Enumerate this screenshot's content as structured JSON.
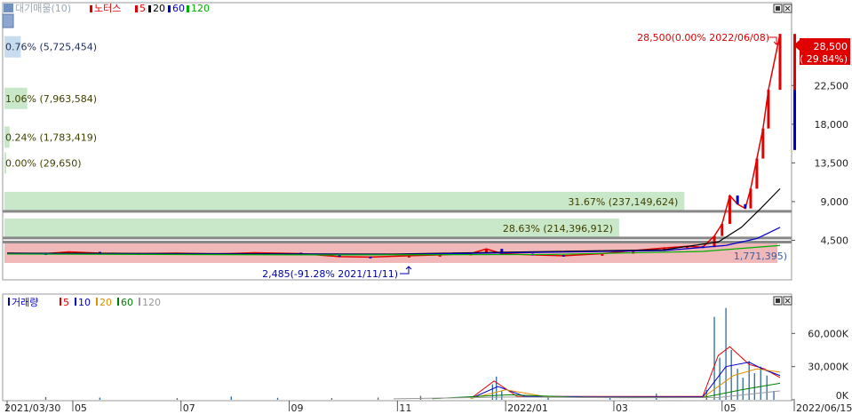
{
  "chart_data": [
    {
      "type": "candlestick",
      "legend_title": "대기매물(10)",
      "legend": [
        {
          "name": "노터스",
          "color": "#e00000"
        },
        {
          "name": "5",
          "color": "#e00000"
        },
        {
          "name": "20",
          "color": "#000000"
        },
        {
          "name": "60",
          "color": "#0000cc"
        },
        {
          "name": "120",
          "color": "#00b000"
        }
      ],
      "y_ticks": [
        "22,500",
        "18,000",
        "13,500",
        "9,000",
        "4,500"
      ],
      "y_tick_values": [
        22500,
        18000,
        13500,
        9000,
        4500
      ],
      "ylim": [
        0,
        31000
      ],
      "price_box": {
        "price": "28,500",
        "change": "( 29.84%)"
      },
      "annotations": {
        "high": "28,500(0.00% 2022/06/08)",
        "low": "2,485(-91.28% 2021/11/11)",
        "ma_label": "1,771,395)"
      },
      "volume_profile": [
        {
          "label": "0.76% (5,725,454)",
          "price": 27000,
          "pct": 0.76
        },
        {
          "label": "1.06% (7,963,584)",
          "price": 21000,
          "pct": 1.06
        },
        {
          "label": "0.24% (1,783,419)",
          "price": 16500,
          "pct": 0.24
        },
        {
          "label": "0.00% (29,650)",
          "price": 13500,
          "pct": 0.0
        },
        {
          "label": "31.67% (237,149,624)",
          "price": 9000,
          "pct": 31.67
        },
        {
          "label": "28.63% (214,396,912)",
          "price": 5900,
          "pct": 28.63
        },
        {
          "label": "",
          "price": 3000,
          "pct": 36.0
        }
      ],
      "price_series": [
        {
          "t": 0.0,
          "close": 3000
        },
        {
          "t": 0.05,
          "close": 2950
        },
        {
          "t": 0.08,
          "close": 3150
        },
        {
          "t": 0.12,
          "close": 3000
        },
        {
          "t": 0.17,
          "close": 2950
        },
        {
          "t": 0.22,
          "close": 3000
        },
        {
          "t": 0.27,
          "close": 2900
        },
        {
          "t": 0.32,
          "close": 3050
        },
        {
          "t": 0.38,
          "close": 2950
        },
        {
          "t": 0.43,
          "close": 2600
        },
        {
          "t": 0.47,
          "close": 2550
        },
        {
          "t": 0.52,
          "close": 2700
        },
        {
          "t": 0.56,
          "close": 2800
        },
        {
          "t": 0.6,
          "close": 2950
        },
        {
          "t": 0.62,
          "close": 3500
        },
        {
          "t": 0.64,
          "close": 2950
        },
        {
          "t": 0.68,
          "close": 2800
        },
        {
          "t": 0.72,
          "close": 2700
        },
        {
          "t": 0.77,
          "close": 2950
        },
        {
          "t": 0.81,
          "close": 3300
        },
        {
          "t": 0.85,
          "close": 3600
        },
        {
          "t": 0.88,
          "close": 3800
        },
        {
          "t": 0.9,
          "close": 3700
        },
        {
          "t": 0.915,
          "close": 5000
        },
        {
          "t": 0.925,
          "close": 6400
        },
        {
          "t": 0.935,
          "close": 9700
        },
        {
          "t": 0.945,
          "close": 8700
        },
        {
          "t": 0.955,
          "close": 8200
        },
        {
          "t": 0.962,
          "close": 10500
        },
        {
          "t": 0.97,
          "close": 14000
        },
        {
          "t": 0.978,
          "close": 17500
        },
        {
          "t": 0.985,
          "close": 22000
        },
        {
          "t": 1.0,
          "close": 28500
        }
      ],
      "ma_series": [
        {
          "name": "20",
          "color": "#000000",
          "points": [
            [
              0.0,
              3000
            ],
            [
              0.5,
              2900
            ],
            [
              0.85,
              3400
            ],
            [
              0.92,
              4300
            ],
            [
              0.95,
              6000
            ],
            [
              0.975,
              8200
            ],
            [
              1.0,
              10500
            ]
          ]
        },
        {
          "name": "60",
          "color": "#0000cc",
          "points": [
            [
              0.0,
              2950
            ],
            [
              0.5,
              2850
            ],
            [
              0.85,
              3300
            ],
            [
              0.93,
              3900
            ],
            [
              0.97,
              4700
            ],
            [
              1.0,
              6000
            ]
          ]
        },
        {
          "name": "120",
          "color": "#00b000",
          "points": [
            [
              0.0,
              2900
            ],
            [
              0.4,
              2800
            ],
            [
              0.7,
              2850
            ],
            [
              0.9,
              3200
            ],
            [
              1.0,
              3900
            ]
          ]
        }
      ]
    },
    {
      "type": "bar",
      "legend_title": "거래량",
      "legend": [
        {
          "name": "5",
          "color": "#e00000"
        },
        {
          "name": "10",
          "color": "#0000cc"
        },
        {
          "name": "20",
          "color": "#e09000"
        },
        {
          "name": "60",
          "color": "#008000"
        },
        {
          "name": "120",
          "color": "#999999"
        }
      ],
      "y_ticks": [
        "60,000K",
        "30,000K",
        "0K"
      ],
      "y_tick_values": [
        60000,
        30000,
        0
      ],
      "ylim": [
        0,
        90000
      ],
      "x_ticks": [
        "2021/03/30",
        "05",
        "07",
        "09",
        "11",
        "2022/01",
        "03",
        "05",
        "2022/06/15"
      ],
      "x_tick_positions": [
        0.0,
        0.085,
        0.225,
        0.365,
        0.505,
        0.645,
        0.785,
        0.925,
        1.0
      ],
      "volume": [
        {
          "t": 0.05,
          "v": 2500
        },
        {
          "t": 0.12,
          "v": 2000
        },
        {
          "t": 0.22,
          "v": 1500
        },
        {
          "t": 0.29,
          "v": 3000
        },
        {
          "t": 0.35,
          "v": 1800
        },
        {
          "t": 0.42,
          "v": 1500
        },
        {
          "t": 0.48,
          "v": 2000
        },
        {
          "t": 0.535,
          "v": 3500
        },
        {
          "t": 0.628,
          "v": 14000
        },
        {
          "t": 0.633,
          "v": 21000
        },
        {
          "t": 0.64,
          "v": 8000
        },
        {
          "t": 0.7,
          "v": 2200
        },
        {
          "t": 0.78,
          "v": 2500
        },
        {
          "t": 0.84,
          "v": 5500
        },
        {
          "t": 0.905,
          "v": 9000
        },
        {
          "t": 0.915,
          "v": 75000
        },
        {
          "t": 0.922,
          "v": 38000
        },
        {
          "t": 0.93,
          "v": 83000
        },
        {
          "t": 0.937,
          "v": 45000
        },
        {
          "t": 0.945,
          "v": 28000
        },
        {
          "t": 0.952,
          "v": 20000
        },
        {
          "t": 0.96,
          "v": 35000
        },
        {
          "t": 0.967,
          "v": 24000
        },
        {
          "t": 0.975,
          "v": 30000
        },
        {
          "t": 0.983,
          "v": 22000
        },
        {
          "t": 0.992,
          "v": 8000
        }
      ],
      "volume_ma": [
        {
          "name": "5",
          "color": "#e00000",
          "points": [
            [
              0.6,
              1200
            ],
            [
              0.63,
              17000
            ],
            [
              0.66,
              3000
            ],
            [
              0.9,
              3000
            ],
            [
              0.92,
              40000
            ],
            [
              0.935,
              48000
            ],
            [
              0.96,
              32000
            ],
            [
              0.98,
              28000
            ],
            [
              1.0,
              20000
            ]
          ]
        },
        {
          "name": "10",
          "color": "#0000cc",
          "points": [
            [
              0.6,
              1200
            ],
            [
              0.635,
              12000
            ],
            [
              0.67,
              3000
            ],
            [
              0.9,
              2500
            ],
            [
              0.93,
              30000
            ],
            [
              0.96,
              34000
            ],
            [
              0.98,
              27000
            ],
            [
              1.0,
              22000
            ]
          ]
        },
        {
          "name": "20",
          "color": "#e09000",
          "points": [
            [
              0.6,
              1100
            ],
            [
              0.645,
              9000
            ],
            [
              0.7,
              2500
            ],
            [
              0.9,
              2000
            ],
            [
              0.94,
              22000
            ],
            [
              0.97,
              28000
            ],
            [
              1.0,
              25000
            ]
          ]
        },
        {
          "name": "60",
          "color": "#008000",
          "points": [
            [
              0.55,
              1000
            ],
            [
              0.65,
              4500
            ],
            [
              0.75,
              2000
            ],
            [
              0.9,
              2000
            ],
            [
              0.95,
              9000
            ],
            [
              1.0,
              15000
            ]
          ]
        },
        {
          "name": "120",
          "color": "#999999",
          "points": [
            [
              0.5,
              900
            ],
            [
              0.65,
              2500
            ],
            [
              0.8,
              1800
            ],
            [
              0.92,
              2000
            ],
            [
              1.0,
              8000
            ]
          ]
        }
      ]
    }
  ]
}
